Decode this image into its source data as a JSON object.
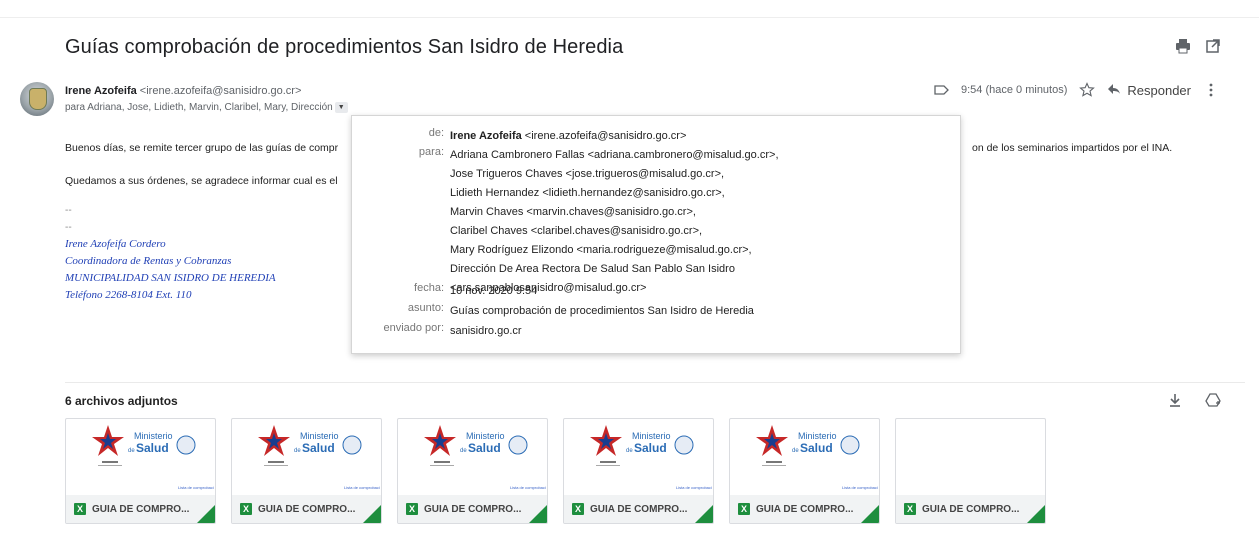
{
  "subject": "Guías comprobación de procedimientos San Isidro de Heredia",
  "sender": {
    "name": "Irene Azofeifa",
    "email": "<irene.azofeifa@sanisidro.go.cr>",
    "recipients": "para Adriana, Jose, Lidieth, Marvin, Claribel, Mary, Dirección"
  },
  "meta": {
    "time": "9:54 (hace 0 minutos)",
    "reply_label": "Responder"
  },
  "body": {
    "line1_start": "Buenos días, se remite tercer grupo de las guías de compr",
    "line1_end": "on de los seminarios  impartidos por el INA.",
    "line2": "Quedamos a sus órdenes, se agradece informar cual es el",
    "dash1": "--",
    "dash2": "--"
  },
  "signature": [
    "Irene Azofeifa Cordero",
    "Coordinadora de Rentas y Cobranzas",
    "MUNICIPALIDAD SAN ISIDRO DE HEREDIA",
    "Teléfono 2268-8104  Ext. 110"
  ],
  "popup": {
    "labels": {
      "from": "de:",
      "to": "para:",
      "date": "fecha:",
      "subject": "asunto:",
      "sent_by": "enviado por:"
    },
    "from_name": "Irene Azofeifa",
    "from_email": "<irene.azofeifa@sanisidro.go.cr>",
    "to_lines": [
      "Adriana Cambronero Fallas <adriana.cambronero@misalud.go.cr>,",
      "Jose Trigueros Chaves <jose.trigueros@misalud.go.cr>,",
      "Lidieth Hernandez <lidieth.hernandez@sanisidro.go.cr>,",
      "Marvin Chaves <marvin.chaves@sanisidro.go.cr>,",
      "Claribel Chaves <claribel.chaves@sanisidro.go.cr>,",
      "Mary Rodríguez Elizondo <maria.rodrigueze@misalud.go.cr>,",
      "Dirección De Area Rectora De Salud San Pablo San Isidro",
      "<ars.sanpablosanisidro@misalud.go.cr>"
    ],
    "date": "10 nov. 2020 9:54",
    "subject": "Guías comprobación de procedimientos San Isidro de Heredia",
    "sent_by": "sanisidro.go.cr"
  },
  "attachments": {
    "title": "6 archivos adjuntos",
    "files": [
      {
        "name": "GUIA DE COMPRO...",
        "thumb": true
      },
      {
        "name": "GUIA DE COMPRO...",
        "thumb": true
      },
      {
        "name": "GUIA DE COMPRO...",
        "thumb": true
      },
      {
        "name": "GUIA DE COMPRO...",
        "thumb": true
      },
      {
        "name": "GUIA DE COMPRO...",
        "thumb": true
      },
      {
        "name": "GUIA DE COMPRO...",
        "thumb": false
      }
    ],
    "thumb_text": {
      "ministerio": "Ministerio",
      "de": "de",
      "salud": "Salud",
      "tiny": "Lista de comprobaci"
    }
  },
  "colors": {
    "accent_green": "#1e8e3e",
    "signature_blue": "#1f3fb5",
    "salud_blue": "#2b6cb5"
  }
}
